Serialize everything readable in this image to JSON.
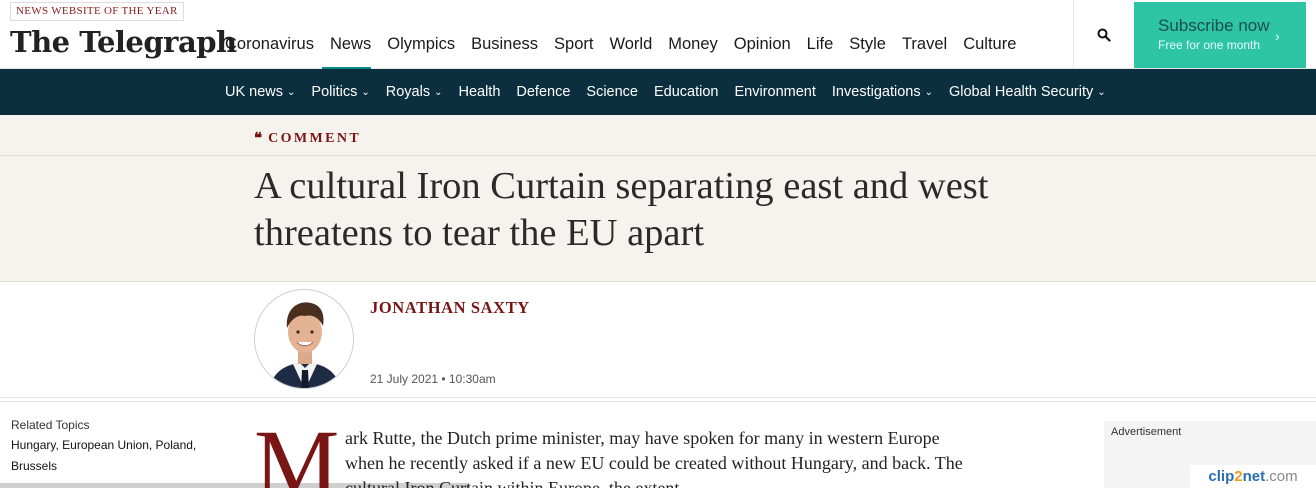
{
  "header": {
    "award": "NEWS WEBSITE OF THE YEAR",
    "logo": "The Telegraph",
    "nav": [
      {
        "label": "Coronavirus"
      },
      {
        "label": "News",
        "active": true
      },
      {
        "label": "Olympics"
      },
      {
        "label": "Business"
      },
      {
        "label": "Sport"
      },
      {
        "label": "World"
      },
      {
        "label": "Money"
      },
      {
        "label": "Opinion"
      },
      {
        "label": "Life"
      },
      {
        "label": "Style"
      },
      {
        "label": "Travel"
      },
      {
        "label": "Culture"
      }
    ],
    "search_icon": "search-icon",
    "subscribe": {
      "label": "Subscribe now",
      "sub": "Free for one month",
      "arrow": "›"
    },
    "accent_color": "#2ec4a6"
  },
  "subnav": {
    "items": [
      {
        "label": "UK news",
        "dropdown": true
      },
      {
        "label": "Politics",
        "dropdown": true
      },
      {
        "label": "Royals",
        "dropdown": true
      },
      {
        "label": "Health",
        "dropdown": false
      },
      {
        "label": "Defence",
        "dropdown": false
      },
      {
        "label": "Science",
        "dropdown": false
      },
      {
        "label": "Education",
        "dropdown": false
      },
      {
        "label": "Environment",
        "dropdown": false
      },
      {
        "label": "Investigations",
        "dropdown": true
      },
      {
        "label": "Global Health Security",
        "dropdown": true
      }
    ],
    "background": "#0c2f3f"
  },
  "article": {
    "section": "COMMENT",
    "headline": "A cultural Iron Curtain separating east and west threatens to tear the EU apart",
    "author": "JONATHAN SAXTY",
    "date": "21 July 2021 • 10:30am",
    "dropcap": "M",
    "lead": "ark Rutte, the Dutch prime minister, may have spoken for many in western Europe when he recently asked if a new EU could be created without Hungary, and back. The cultural Iron Curtain within Europe, the extent"
  },
  "related": {
    "title": "Related Topics",
    "topics": [
      "Hungary",
      "European Union",
      "Poland",
      "Brussels"
    ]
  },
  "ad": {
    "label": "Advertisement"
  },
  "watermark": {
    "text_a": "clip",
    "text_b": "2",
    "text_c": "net",
    "text_d": ".com"
  }
}
